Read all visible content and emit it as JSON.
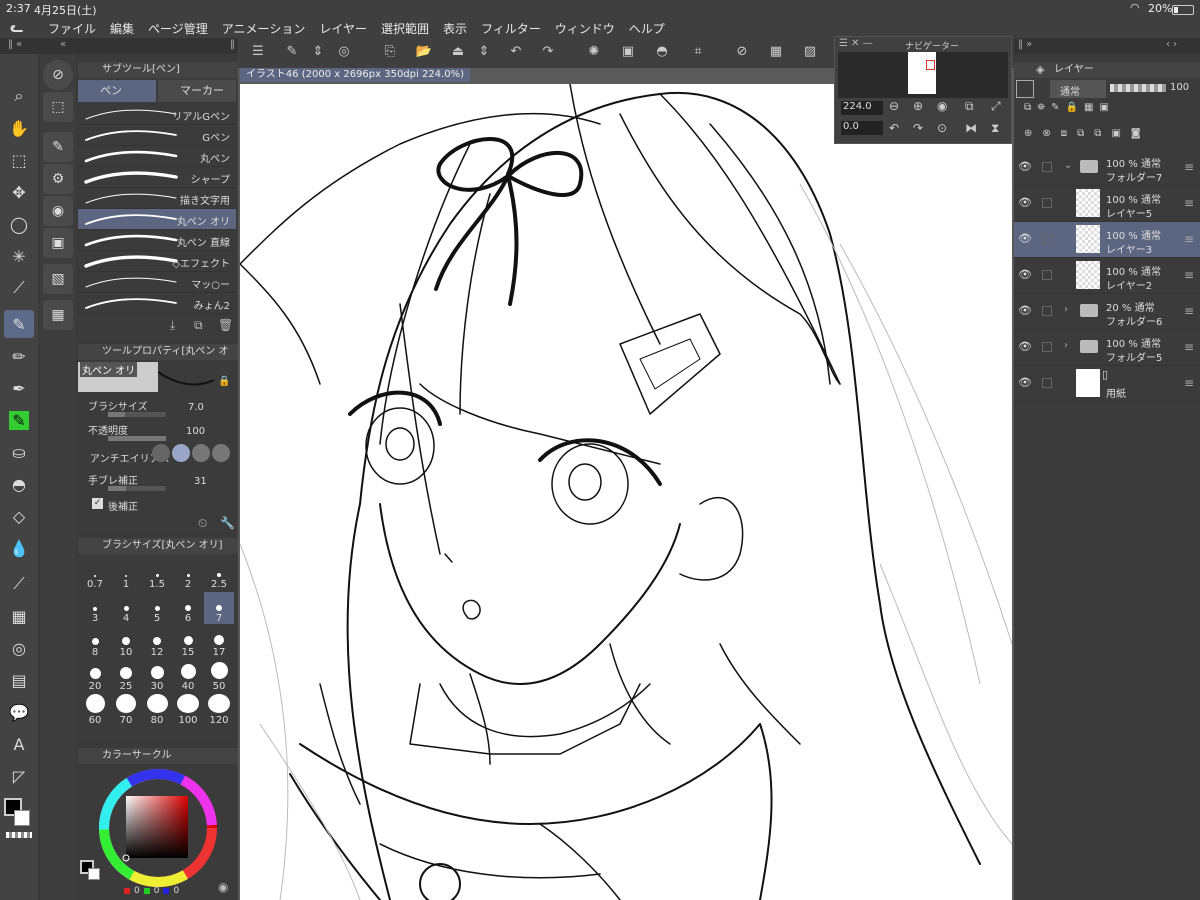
{
  "status": {
    "time": "2:37",
    "date": "4月25日(土)",
    "battery": "20%"
  },
  "menu": [
    "ファイル",
    "編集",
    "ページ管理",
    "アニメーション",
    "レイヤー",
    "選択範囲",
    "表示",
    "フィルター",
    "ウィンドウ",
    "ヘルプ"
  ],
  "subtool": {
    "title": "サブツール[ペン]",
    "tab_pen": "ペン",
    "tab_marker": "マーカー",
    "brushes": [
      "リアルGペン",
      "Gペン",
      "丸ペン",
      "シャープ",
      "描き文字用",
      "丸ペン オリ",
      "丸ペン 直線",
      "◇エフェクト",
      "マッ○ー",
      "みょん2"
    ],
    "selected_index": 5
  },
  "toolprop": {
    "title": "ツールプロパティ[丸ペン オリ",
    "preview_name": "丸ペン オリ",
    "brush_size_label": "ブラシサイズ",
    "brush_size_value": "7.0",
    "opacity_label": "不透明度",
    "opacity_value": "100",
    "aa_label": "アンチエイリアス",
    "stab_label": "手ブレ補正",
    "stab_value": "31",
    "post_label": "後補正"
  },
  "brushsize": {
    "title": "ブラシサイズ[丸ペン オリ]",
    "sizes": [
      "0.7",
      "1",
      "1.5",
      "2",
      "2.5",
      "3",
      "4",
      "5",
      "6",
      "7",
      "8",
      "10",
      "12",
      "15",
      "17",
      "20",
      "25",
      "30",
      "40",
      "50",
      "60",
      "70",
      "80",
      "100",
      "120"
    ],
    "selected": "7"
  },
  "color": {
    "title": "カラーサークル",
    "r": "0",
    "g": "0",
    "b": "0",
    "main": "#000000",
    "sub": "#ffffff"
  },
  "document": {
    "tab": "イラスト46 (2000 x 2696px 350dpi 224.0%)"
  },
  "navigator": {
    "title": "ナビゲーター",
    "zoom": "224.0",
    "rotation": "0.0"
  },
  "layers": {
    "title": "レイヤー",
    "blend": "通常",
    "opacity": "100",
    "items": [
      {
        "l1": "100 % 通常",
        "l2": "フォルダー7",
        "type": "folder",
        "open": true
      },
      {
        "l1": "100 % 通常",
        "l2": "レイヤー5",
        "type": "layer"
      },
      {
        "l1": "100 % 通常",
        "l2": "レイヤー3",
        "type": "layer",
        "selected": true
      },
      {
        "l1": "100 % 通常",
        "l2": "レイヤー2",
        "type": "layer"
      },
      {
        "l1": "20 % 通常",
        "l2": "フォルダー6",
        "type": "folder"
      },
      {
        "l1": "100 % 通常",
        "l2": "フォルダー5",
        "type": "folder"
      },
      {
        "l1": "",
        "l2": "用紙",
        "type": "paper"
      }
    ]
  }
}
